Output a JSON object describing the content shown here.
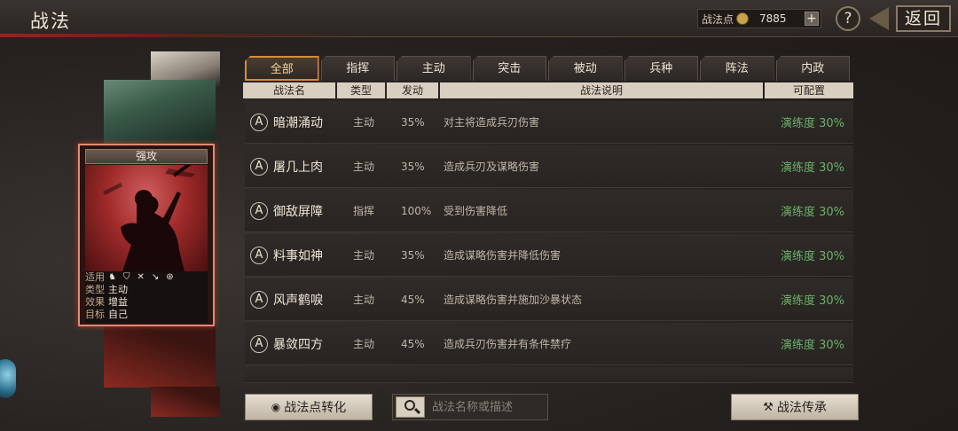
{
  "header": {
    "title": "战法",
    "points_label": "战法点",
    "points_value": "7885",
    "plus_label": "+",
    "help_label": "?",
    "back_label": "返回"
  },
  "card": {
    "title": "强攻",
    "info": [
      {
        "key": "适用",
        "value": ""
      },
      {
        "key": "类型",
        "value": "主动"
      },
      {
        "key": "效果",
        "value": "增益"
      },
      {
        "key": "目标",
        "value": "自己"
      }
    ],
    "troop_icons": [
      "cavalry-icon",
      "shield-icon",
      "bow-icon",
      "spear-icon",
      "wheel-icon"
    ]
  },
  "tabs": [
    {
      "label": "全部",
      "active": true
    },
    {
      "label": "指挥",
      "active": false
    },
    {
      "label": "主动",
      "active": false
    },
    {
      "label": "突击",
      "active": false
    },
    {
      "label": "被动",
      "active": false
    },
    {
      "label": "兵种",
      "active": false
    },
    {
      "label": "阵法",
      "active": false
    },
    {
      "label": "内政",
      "active": false
    }
  ],
  "columns": {
    "name": "战法名",
    "type": "类型",
    "rate": "发动",
    "desc": "战法说明",
    "config": "可配置"
  },
  "skills": [
    {
      "grade": "A",
      "name": "暗潮涌动",
      "type": "主动",
      "rate": "35%",
      "desc": "对主将造成兵刃伤害",
      "prof": "演练度 30%"
    },
    {
      "grade": "A",
      "name": "屠几上肉",
      "type": "主动",
      "rate": "35%",
      "desc": "造成兵刃及谋略伤害",
      "prof": "演练度 30%"
    },
    {
      "grade": "A",
      "name": "御敌屏障",
      "type": "指挥",
      "rate": "100%",
      "desc": "受到伤害降低",
      "prof": "演练度 30%"
    },
    {
      "grade": "A",
      "name": "料事如神",
      "type": "主动",
      "rate": "35%",
      "desc": "造成谋略伤害并降低伤害",
      "prof": "演练度 30%"
    },
    {
      "grade": "A",
      "name": "风声鹤唳",
      "type": "主动",
      "rate": "45%",
      "desc": "造成谋略伤害并施加沙暴状态",
      "prof": "演练度 30%"
    },
    {
      "grade": "A",
      "name": "暴敛四方",
      "type": "主动",
      "rate": "45%",
      "desc": "造成兵刃伤害并有条件禁疗",
      "prof": "演练度 30%"
    }
  ],
  "bottom": {
    "convert_label": "战法点转化",
    "search_placeholder": "战法名称或描述",
    "inherit_label": "战法传承"
  },
  "colors": {
    "accent": "#d98a3a",
    "proficiency": "#6ab06a",
    "card_border": "#e08a72"
  }
}
